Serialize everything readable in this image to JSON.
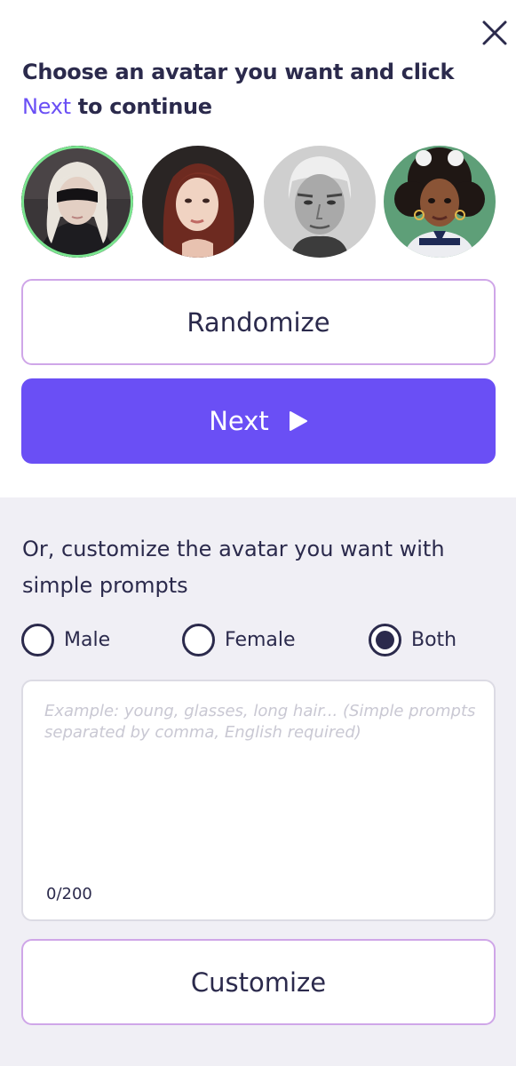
{
  "header": {
    "title_part1": "Choose an avatar you want and click",
    "title_accent": "Next",
    "title_part2": "to continue"
  },
  "avatars": [
    {
      "name": "avatar-blindfold-girl",
      "selected": true
    },
    {
      "name": "avatar-red-hair-woman",
      "selected": false
    },
    {
      "name": "avatar-silver-hair-man",
      "selected": false
    },
    {
      "name": "avatar-curly-hair-girl",
      "selected": false
    }
  ],
  "buttons": {
    "randomize": "Randomize",
    "next": "Next",
    "customize": "Customize"
  },
  "customize": {
    "heading": "Or, customize the avatar you want with simple prompts",
    "gender_options": [
      {
        "label": "Male",
        "selected": false
      },
      {
        "label": "Female",
        "selected": false
      },
      {
        "label": "Both",
        "selected": true
      }
    ],
    "prompt_value": "",
    "prompt_placeholder": "Example: young, glasses, long hair... (Simple prompts separated by comma, English required)",
    "counter": "0/200"
  },
  "colors": {
    "accent": "#6a4ff5",
    "text": "#2b2a4c",
    "selected_ring": "#7ae58f",
    "outline_border": "#cfa6e8"
  },
  "icons": {
    "close": "close-icon",
    "next": "play-icon"
  }
}
